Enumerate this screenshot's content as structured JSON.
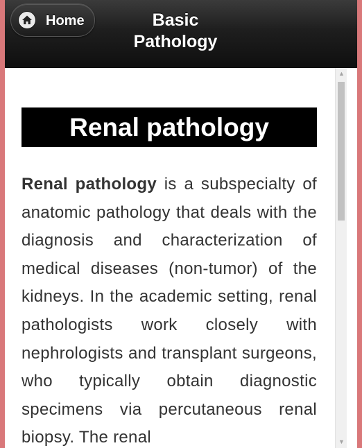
{
  "header": {
    "home_label": "Home",
    "title": "Basic Pathology",
    "home_icon": "home-icon"
  },
  "article": {
    "title": "Renal pathology",
    "lead_term": "Renal pathology",
    "body": " is a subspecialty of anatomic pathology that deals with the diagnosis and characterization of medical diseases (non-tumor) of the kidneys. In the academic setting, renal pathologists work closely with nephrologists and transplant surgeons, who typically obtain diagnostic specimens via percutaneous renal biopsy. The renal"
  },
  "scrollbar": {
    "up_arrow": "▲",
    "down_arrow": "▼",
    "position": 0.0
  }
}
